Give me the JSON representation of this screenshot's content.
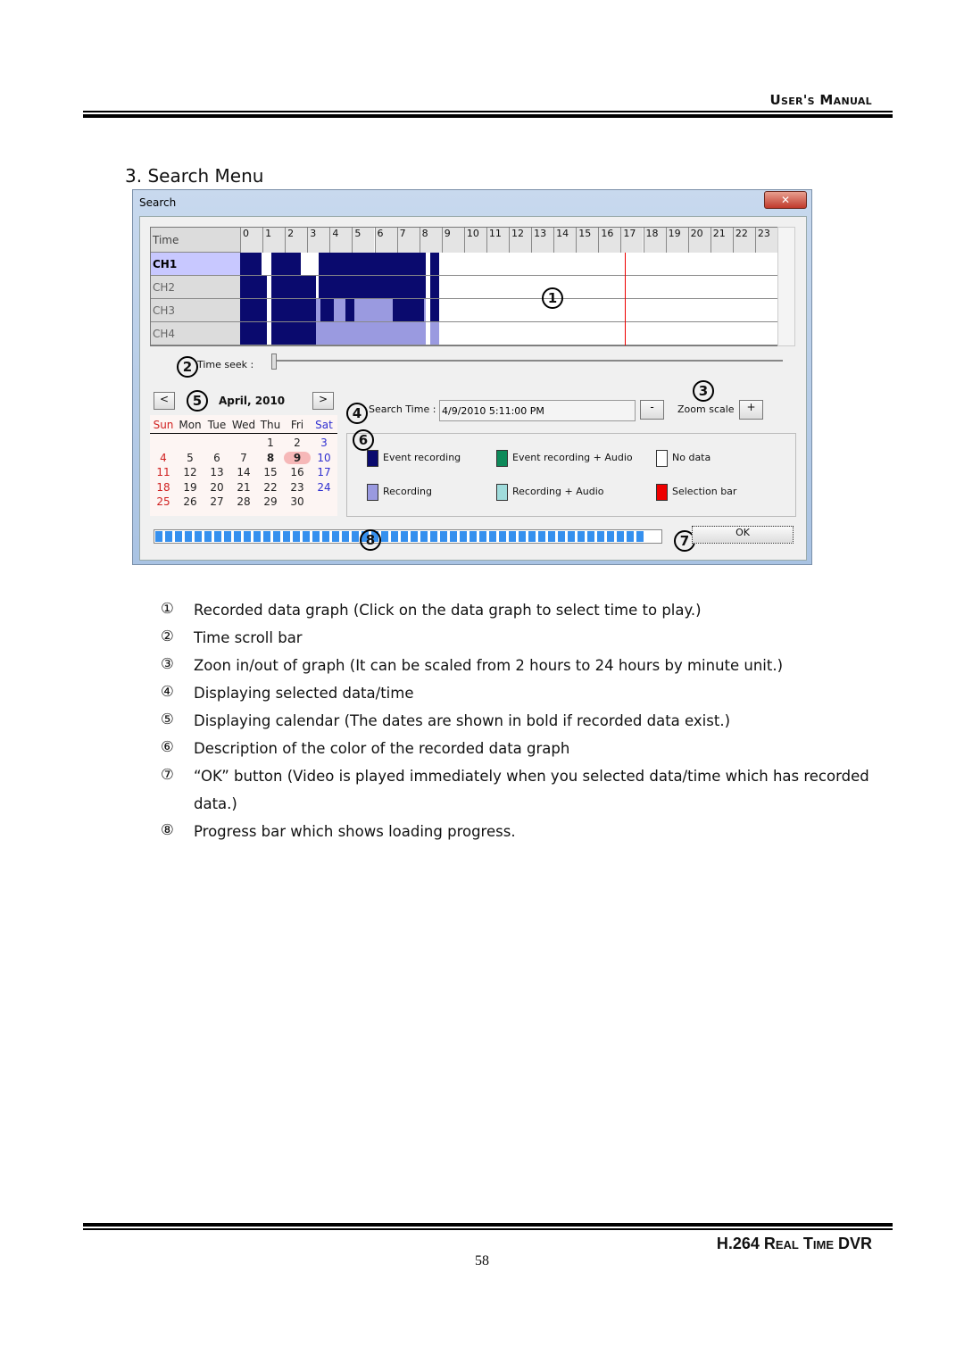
{
  "header": {
    "title": "User's Manual"
  },
  "footer": {
    "title": "H.264 Real Time DVR",
    "page": "58"
  },
  "section": {
    "title": "3.  Search Menu"
  },
  "window": {
    "title": "Search",
    "close_label": "✕"
  },
  "graph": {
    "time_label": "Time",
    "hours": [
      "0",
      "1",
      "2",
      "3",
      "4",
      "5",
      "6",
      "7",
      "8",
      "9",
      "10",
      "11",
      "12",
      "13",
      "14",
      "15",
      "16",
      "17",
      "18",
      "19",
      "20",
      "21",
      "22",
      "23"
    ],
    "channels": [
      {
        "label": "CH1",
        "selected": true,
        "segments": [
          {
            "type": "event",
            "start": 0,
            "end": 0.95
          },
          {
            "type": "event",
            "start": 1.4,
            "end": 2.7
          },
          {
            "type": "event",
            "start": 3.5,
            "end": 8.3
          },
          {
            "type": "event",
            "start": 8.5,
            "end": 8.9
          }
        ]
      },
      {
        "label": "CH2",
        "segments": [
          {
            "type": "event",
            "start": 0,
            "end": 1.2
          },
          {
            "type": "event",
            "start": 1.4,
            "end": 3.4
          },
          {
            "type": "event",
            "start": 3.5,
            "end": 8.3
          },
          {
            "type": "event",
            "start": 8.5,
            "end": 8.9
          }
        ]
      },
      {
        "label": "CH3",
        "segments": [
          {
            "type": "event",
            "start": 0,
            "end": 1.2
          },
          {
            "type": "event",
            "start": 1.4,
            "end": 3.4
          },
          {
            "type": "recording",
            "start": 3.4,
            "end": 8.3
          },
          {
            "type": "event",
            "start": 3.6,
            "end": 4.2
          },
          {
            "type": "event",
            "start": 4.7,
            "end": 5.1
          },
          {
            "type": "event",
            "start": 6.8,
            "end": 8.2
          },
          {
            "type": "event",
            "start": 8.5,
            "end": 8.9
          }
        ]
      },
      {
        "label": "CH4",
        "segments": [
          {
            "type": "event",
            "start": 0,
            "end": 1.2
          },
          {
            "type": "event",
            "start": 1.4,
            "end": 3.4
          },
          {
            "type": "recording",
            "start": 3.4,
            "end": 8.3
          },
          {
            "type": "recording",
            "start": 8.5,
            "end": 8.9
          }
        ]
      }
    ],
    "selection_hour": 17.18
  },
  "seek": {
    "label": "Time seek :",
    "value": 0
  },
  "calendar": {
    "month": "April, 2010",
    "prev": "<",
    "next": ">",
    "weekdays": [
      "Sun",
      "Mon",
      "Tue",
      "Wed",
      "Thu",
      "Fri",
      "Sat"
    ],
    "weeks": [
      [
        "",
        "",
        "",
        "",
        "1",
        "2",
        "3"
      ],
      [
        "4",
        "5",
        "6",
        "7",
        "8",
        "9",
        "10"
      ],
      [
        "11",
        "12",
        "13",
        "14",
        "15",
        "16",
        "17"
      ],
      [
        "18",
        "19",
        "20",
        "21",
        "22",
        "23",
        "24"
      ],
      [
        "25",
        "26",
        "27",
        "28",
        "29",
        "30",
        ""
      ]
    ],
    "bold_days": [
      "8",
      "9"
    ],
    "selected_day": "9"
  },
  "search": {
    "label": "Search Time :",
    "value": "4/9/2010 5:11:00 PM"
  },
  "zoom": {
    "minus": "-",
    "label": "Zoom scale",
    "plus": "+"
  },
  "legend": [
    {
      "label": "Event recording",
      "color": "#0a0a6e"
    },
    {
      "label": "Event recording + Audio",
      "color": "#0e8a5a"
    },
    {
      "label": "No data",
      "color": "#ffffff"
    },
    {
      "label": "Recording",
      "color": "#9a9ae0"
    },
    {
      "label": "Recording + Audio",
      "color": "#a0dcdc"
    },
    {
      "label": "Selection bar",
      "color": "#ee0000"
    }
  ],
  "progress": {
    "percent": 100
  },
  "ok_label": "OK",
  "callouts": [
    "1",
    "2",
    "3",
    "4",
    "5",
    "6",
    "7",
    "8"
  ],
  "descriptions": [
    {
      "n": "①",
      "t": "Recorded data graph (Click on the data graph to select time to play.)"
    },
    {
      "n": "②",
      "t": "Time scroll bar"
    },
    {
      "n": "③",
      "t": "Zoon in/out of graph (It can be scaled from 2 hours to 24 hours by minute unit.)"
    },
    {
      "n": "④",
      "t": "Displaying selected data/time"
    },
    {
      "n": "⑤",
      "t": "Displaying calendar (The dates are shown in bold if recorded data exist.)"
    },
    {
      "n": "⑥",
      "t": "Description of the color of the recorded data graph"
    },
    {
      "n": "⑦",
      "t": "“OK” button (Video is played immediately when you selected data/time which has recorded data.)"
    },
    {
      "n": "⑧",
      "t": "Progress bar which shows loading progress."
    }
  ]
}
